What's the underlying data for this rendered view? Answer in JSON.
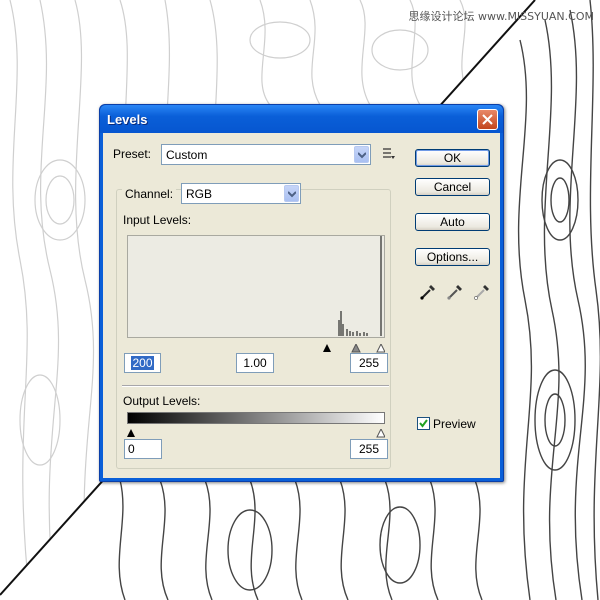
{
  "watermark": "思缘设计论坛 www.MISSYUAN.COM",
  "dialog": {
    "title": "Levels",
    "preset_label": "Preset:",
    "preset_value": "Custom",
    "channel_label": "Channel:",
    "channel_value": "RGB",
    "input_levels_label": "Input Levels:",
    "input_black": "200",
    "input_gamma": "1.00",
    "input_white": "255",
    "output_levels_label": "Output Levels:",
    "output_black": "0",
    "output_white": "255",
    "buttons": {
      "ok": "OK",
      "cancel": "Cancel",
      "auto": "Auto",
      "options": "Options..."
    },
    "preview_label": "Preview",
    "preview_checked": true
  },
  "colors": {
    "titlebar": "#0a5fd8",
    "dialog_bg": "#ece9d8",
    "selection": "#316ac5"
  }
}
